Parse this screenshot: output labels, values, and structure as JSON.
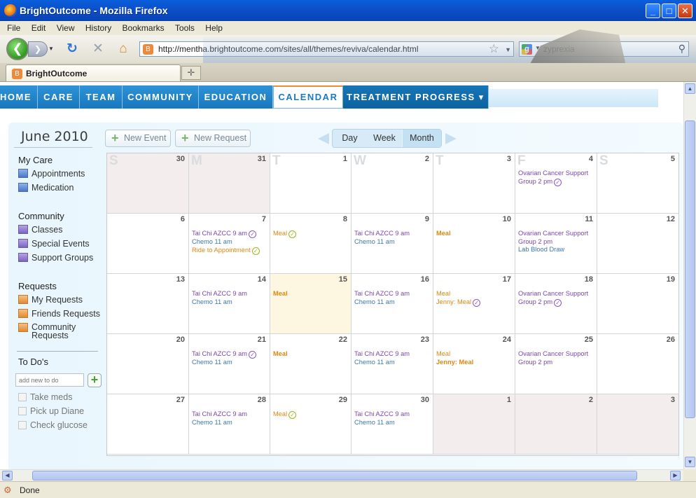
{
  "window": {
    "title": "BrightOutcome - Mozilla Firefox",
    "minimize": "_",
    "maximize": "□",
    "close": "✕"
  },
  "menu": [
    "File",
    "Edit",
    "View",
    "History",
    "Bookmarks",
    "Tools",
    "Help"
  ],
  "toolbar": {
    "url": "http://mentha.brightoutcome.com/sites/all/themes/reviva/calendar.html",
    "search_value": "zyprexia",
    "icons": [
      "back-arrow-icon",
      "forward-arrow-icon",
      "reload-icon",
      "stop-icon",
      "home-icon",
      "bookmark-star-icon",
      "google-icon",
      "magnifier-icon"
    ]
  },
  "tabs": [
    {
      "label": "BrightOutcome"
    }
  ],
  "site_nav": {
    "items": [
      "HOME",
      "CARE",
      "TEAM",
      "COMMUNITY",
      "EDUCATION",
      "CALENDAR",
      "TREATMENT PROGRESS ▾"
    ],
    "active": "CALENDAR"
  },
  "sidebar": {
    "month_title": "June 2010",
    "sections": [
      {
        "heading": "My Care",
        "items": [
          "Appointments",
          "Medication"
        ]
      },
      {
        "heading": "Community",
        "items": [
          "Classes",
          "Special Events",
          "Support Groups"
        ]
      },
      {
        "heading": "Requests",
        "items": [
          "My Requests",
          "Friends Requests",
          "Community Requests"
        ]
      }
    ],
    "todo_heading": "To Do's",
    "todo_placeholder": "add new to do",
    "todo_add": "+",
    "todos": [
      "Take meds",
      "Pick up Diane",
      "Check glucose"
    ]
  },
  "calendar_toolbar": {
    "new_event": "New Event",
    "new_request": "New Request",
    "views": [
      "Day",
      "Week",
      "Month"
    ],
    "active_view": "Month"
  },
  "calendar": {
    "weekday_letters": [
      "S",
      "M",
      "T",
      "W",
      "T",
      "F",
      "S"
    ],
    "weeks": [
      [
        {
          "day": "30",
          "other": true,
          "events": []
        },
        {
          "day": "31",
          "other": true,
          "events": []
        },
        {
          "day": "1",
          "events": []
        },
        {
          "day": "2",
          "events": []
        },
        {
          "day": "3",
          "events": []
        },
        {
          "day": "4",
          "events": [
            {
              "text": "Ovarian Cancer Support Group 2 pm",
              "color": "purple",
              "check": "purple"
            }
          ]
        },
        {
          "day": "5",
          "events": []
        }
      ],
      [
        {
          "day": "6",
          "events": []
        },
        {
          "day": "7",
          "events": [
            {
              "text": "Tai Chi AZCC 9 am",
              "color": "purple",
              "check": "purple"
            },
            {
              "text": "Chemo 11 am",
              "color": "blue"
            },
            {
              "text": "Ride to Appointment",
              "color": "orange",
              "check": "green"
            }
          ]
        },
        {
          "day": "8",
          "events": [
            {
              "text": "Meal",
              "color": "orange",
              "check": "green"
            }
          ]
        },
        {
          "day": "9",
          "events": [
            {
              "text": "Tai Chi AZCC 9 am",
              "color": "purple"
            },
            {
              "text": "Chemo 11 am",
              "color": "blue"
            }
          ]
        },
        {
          "day": "10",
          "events": [
            {
              "text": "Meal",
              "color": "orange",
              "bold": true
            }
          ]
        },
        {
          "day": "11",
          "events": [
            {
              "text": "Ovarian Cancer Support Group 2 pm",
              "color": "purple"
            },
            {
              "text": "Lab Blood Draw",
              "color": "blue"
            }
          ]
        },
        {
          "day": "12",
          "events": []
        }
      ],
      [
        {
          "day": "13",
          "events": []
        },
        {
          "day": "14",
          "events": [
            {
              "text": "Tai Chi AZCC 9 am",
              "color": "purple"
            },
            {
              "text": "Chemo 11 am",
              "color": "blue"
            }
          ]
        },
        {
          "day": "15",
          "today": true,
          "events": [
            {
              "text": "Meal",
              "color": "orange",
              "bold": true
            }
          ]
        },
        {
          "day": "16",
          "events": [
            {
              "text": "Tai Chi AZCC 9 am",
              "color": "purple"
            },
            {
              "text": "Chemo 11 am",
              "color": "blue"
            }
          ]
        },
        {
          "day": "17",
          "events": [
            {
              "text": "Meal",
              "color": "orange"
            },
            {
              "text": "Jenny: Meal",
              "color": "orange",
              "check": "purple"
            }
          ]
        },
        {
          "day": "18",
          "events": [
            {
              "text": "Ovarian Cancer Support Group 2 pm",
              "color": "purple",
              "check": "purple"
            }
          ]
        },
        {
          "day": "19",
          "events": []
        }
      ],
      [
        {
          "day": "20",
          "events": []
        },
        {
          "day": "21",
          "events": [
            {
              "text": "Tai Chi AZCC 9 am",
              "color": "purple",
              "check": "purple"
            },
            {
              "text": "Chemo 11 am",
              "color": "blue"
            }
          ]
        },
        {
          "day": "22",
          "events": [
            {
              "text": "Meal",
              "color": "orange",
              "bold": true
            }
          ]
        },
        {
          "day": "23",
          "events": [
            {
              "text": "Tai Chi AZCC 9 am",
              "color": "purple"
            },
            {
              "text": "Chemo 11 am",
              "color": "blue"
            }
          ]
        },
        {
          "day": "24",
          "events": [
            {
              "text": "Meal",
              "color": "orange"
            },
            {
              "text": "Jenny: Meal",
              "color": "orange",
              "bold": true
            }
          ]
        },
        {
          "day": "25",
          "events": [
            {
              "text": "Ovarian Cancer Support Group 2 pm",
              "color": "purple"
            }
          ]
        },
        {
          "day": "26",
          "events": []
        }
      ],
      [
        {
          "day": "27",
          "events": []
        },
        {
          "day": "28",
          "events": [
            {
              "text": "Tai Chi AZCC 9 am",
              "color": "purple"
            },
            {
              "text": "Chemo 11 am",
              "color": "blue"
            }
          ]
        },
        {
          "day": "29",
          "events": [
            {
              "text": "Meal",
              "color": "orange",
              "check": "green"
            }
          ]
        },
        {
          "day": "30",
          "events": [
            {
              "text": "Tai Chi AZCC 9 am",
              "color": "purple"
            },
            {
              "text": "Chemo 11 am",
              "color": "blue"
            }
          ]
        },
        {
          "day": "1",
          "other": true,
          "events": []
        },
        {
          "day": "2",
          "other": true,
          "events": []
        },
        {
          "day": "3",
          "other": true,
          "events": []
        }
      ]
    ]
  },
  "status": {
    "text": "Done"
  },
  "colors": {
    "nav_blue": "#1977bd",
    "event_purple": "#7b45b6",
    "event_blue": "#3a77b2",
    "event_orange": "#e3860f",
    "check_green": "#9ab61a",
    "today_bg": "#fdf7e1",
    "other_month_bg": "#f4eded"
  }
}
